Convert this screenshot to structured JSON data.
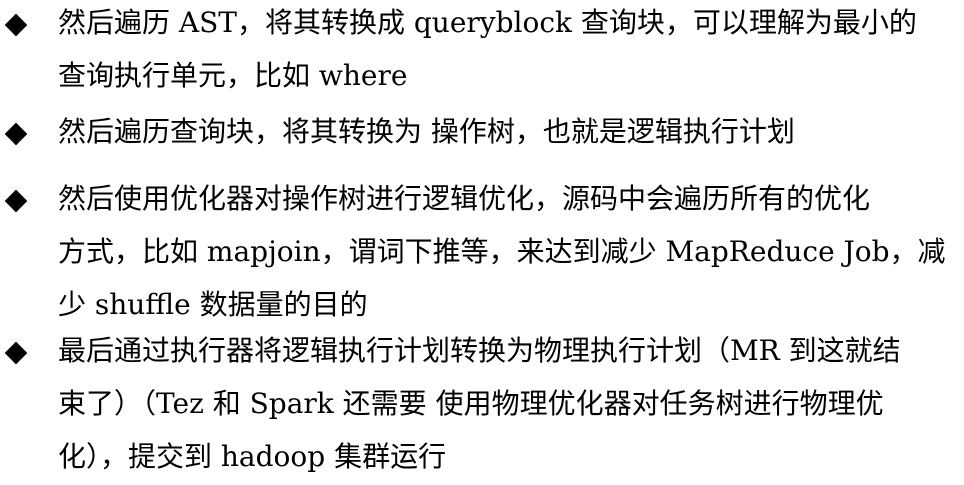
{
  "items": [
    {
      "lines": [
        "然后遍历 AST，将其转换成 queryblock 查询块，可以理解为最小的",
        "查询执行单元，比如 where"
      ]
    },
    {
      "lines": [
        "然后遍历查询块，将其转换为 操作树，也就是逻辑执行计划"
      ]
    },
    {
      "lines": [
        "然后使用优化器对操作树进行逻辑优化，源码中会遍历所有的优化",
        "方式，比如 mapjoin，谓词下推等，来达到减少 MapReduce Job，减",
        "少 shuffle 数据量的目的"
      ]
    },
    {
      "lines": [
        "最后通过执行器将逻辑执行计划转换为物理执行计划（MR 到这就结",
        "束了）（Tez 和 Spark 还需要 使用物理优化器对任务树进行物理优",
        "化），提交到 hadoop 集群运行"
      ]
    }
  ]
}
